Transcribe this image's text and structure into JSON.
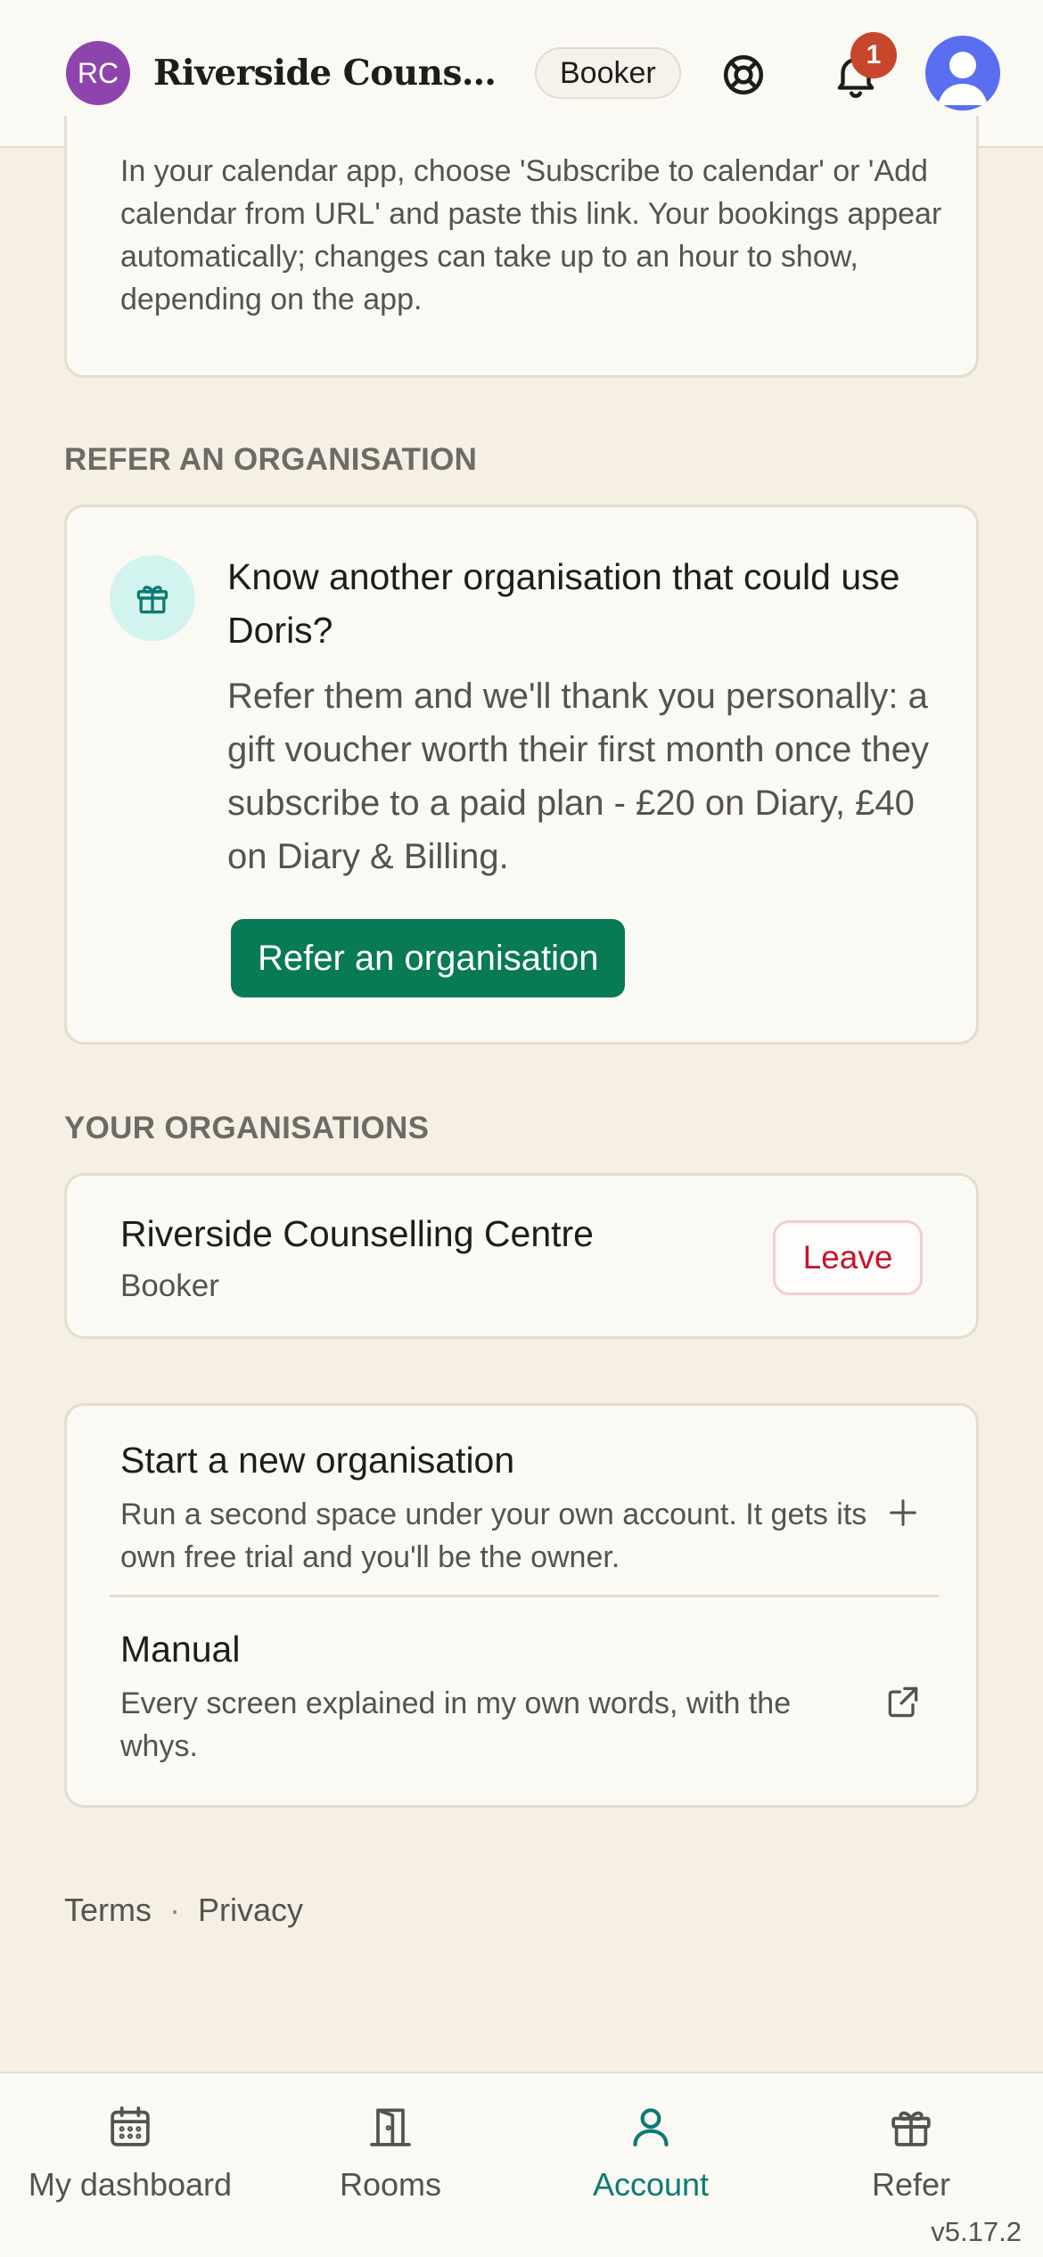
{
  "header": {
    "org_initials": "RC",
    "org_name": "Riverside Counselling Centre",
    "role_pill": "Booker",
    "notification_count": "1"
  },
  "calendar_card": {
    "description": "In your calendar app, choose 'Subscribe to calendar' or 'Add calendar from URL' and paste this link. Your bookings appear automatically; changes can take up to an hour to show, depending on the app."
  },
  "refer_section": {
    "label": "REFER AN ORGANISATION",
    "title": "Know another organisation that could use Doris?",
    "body": "Refer them and we'll thank you personally: a gift voucher worth their first month once they subscribe to a paid plan - £20 on Diary, £40 on Diary & Billing.",
    "button_label": "Refer an organisation"
  },
  "organisations_section": {
    "label": "YOUR ORGANISATIONS",
    "items": [
      {
        "name": "Riverside Counselling Centre",
        "role": "Booker",
        "leave_label": "Leave"
      }
    ]
  },
  "actions": [
    {
      "title": "Start a new organisation",
      "subtitle": "Run a second space under your own account. It gets its own free trial and you'll be the owner.",
      "icon": "plus-icon"
    },
    {
      "title": "Manual",
      "subtitle": "Every screen explained in my own words, with the whys.",
      "icon": "external-link-icon"
    }
  ],
  "footer": {
    "terms": "Terms",
    "separator": "·",
    "privacy": "Privacy"
  },
  "bottom_nav": {
    "items": [
      {
        "label": "My dashboard",
        "icon": "calendar-icon",
        "active": false
      },
      {
        "label": "Rooms",
        "icon": "door-icon",
        "active": false
      },
      {
        "label": "Account",
        "icon": "person-icon",
        "active": true
      },
      {
        "label": "Refer",
        "icon": "gift-icon",
        "active": false
      }
    ],
    "version": "v5.17.2"
  },
  "colors": {
    "background": "#f6efe4",
    "card": "#fbf9f3",
    "primary_green": "#087a55",
    "active_teal": "#0d7a72",
    "danger_red": "#c8142b",
    "badge": "#c8462b",
    "org_avatar": "#8e44ad",
    "user_avatar": "#5a6ef0"
  }
}
